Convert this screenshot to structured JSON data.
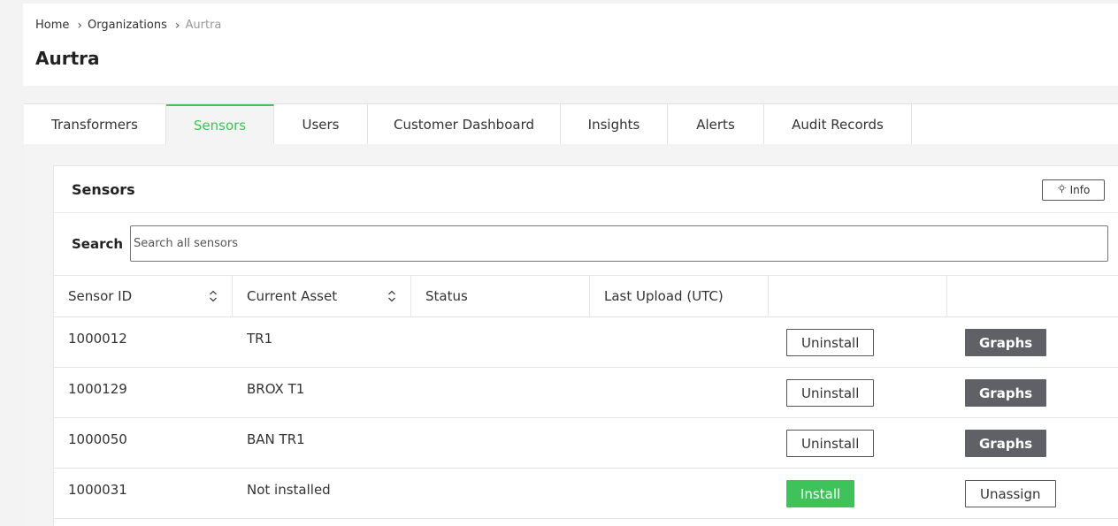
{
  "breadcrumb": {
    "items": [
      "Home",
      "Organizations",
      "Aurtra"
    ]
  },
  "page": {
    "title": "Aurtra"
  },
  "tabs": [
    {
      "label": "Transformers",
      "active": false
    },
    {
      "label": "Sensors",
      "active": true
    },
    {
      "label": "Users",
      "active": false
    },
    {
      "label": "Customer Dashboard",
      "active": false
    },
    {
      "label": "Insights",
      "active": false
    },
    {
      "label": "Alerts",
      "active": false
    },
    {
      "label": "Audit Records",
      "active": false
    }
  ],
  "panel": {
    "title": "Sensors",
    "info_label": "Info",
    "info_icon": "lightbulb-icon",
    "search_label": "Search",
    "search_placeholder": "Search all sensors"
  },
  "table": {
    "columns": [
      "Sensor ID",
      "Current Asset",
      "Status",
      "Last Upload (UTC)",
      "",
      ""
    ],
    "sortable": [
      true,
      true,
      false,
      false,
      false,
      false
    ],
    "rows": [
      {
        "sensor_id": "1000012",
        "asset": "TR1",
        "status": "",
        "last_upload": "",
        "action1": "Uninstall",
        "action2": "Graphs"
      },
      {
        "sensor_id": "1000129",
        "asset": "BROX T1",
        "status": "",
        "last_upload": "",
        "action1": "Uninstall",
        "action2": "Graphs"
      },
      {
        "sensor_id": "1000050",
        "asset": "BAN TR1",
        "status": "",
        "last_upload": "",
        "action1": "Uninstall",
        "action2": "Graphs"
      },
      {
        "sensor_id": "1000031",
        "asset": "Not installed",
        "status": "",
        "last_upload": "",
        "action1": "Install",
        "action2": "Unassign"
      }
    ]
  },
  "colors": {
    "accent": "#3ec35a",
    "dark_button": "#5f6166"
  }
}
